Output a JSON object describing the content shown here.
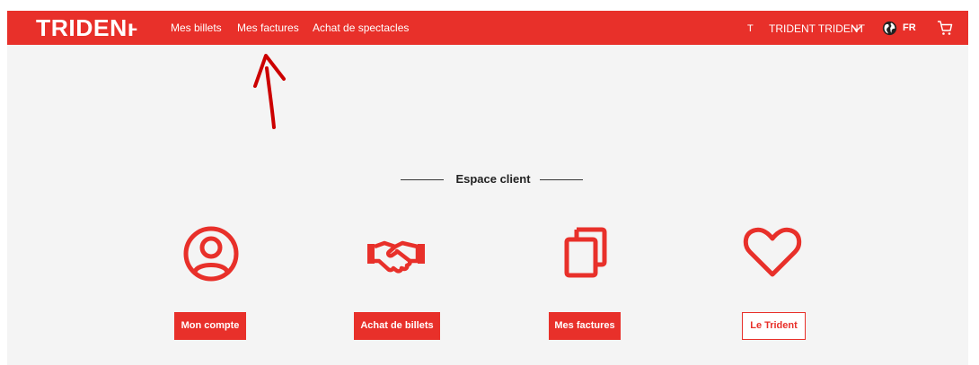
{
  "header": {
    "logo_text": "TRIDENⱶ",
    "nav": [
      "Mes billets",
      "Mes factures",
      "Achat de spectacles"
    ],
    "user_initial": "T",
    "user_name": "TRIDENT TRIDENT",
    "language": "FR",
    "icons": [
      "chevron-down-icon",
      "globe-icon",
      "cart-icon"
    ]
  },
  "main": {
    "section_title": "Espace client",
    "cards": [
      {
        "icon": "user-circle-icon",
        "button_label": "Mon compte"
      },
      {
        "icon": "handshake-icon",
        "button_label": "Achat de billets"
      },
      {
        "icon": "documents-icon",
        "button_label": "Mes factures"
      },
      {
        "icon": "heart-icon",
        "button_label": "Le Trident"
      }
    ]
  },
  "colors": {
    "brand": "#e8302a",
    "background": "#f4f4f4",
    "text": "#222222"
  }
}
